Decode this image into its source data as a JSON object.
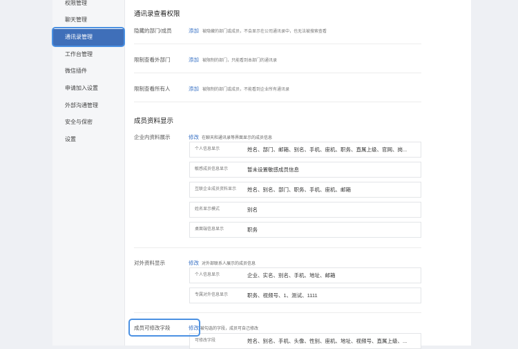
{
  "sidebar": {
    "items": [
      {
        "label": "权限管理"
      },
      {
        "label": "聊天管理"
      },
      {
        "label": "通讯录管理"
      },
      {
        "label": "工作台管理"
      },
      {
        "label": "微信插件"
      },
      {
        "label": "申请加入设置"
      },
      {
        "label": "外部沟通管理"
      },
      {
        "label": "安全与保密"
      },
      {
        "label": "设置"
      }
    ],
    "active_index": 2
  },
  "permissions": {
    "title": "通讯录查看权限",
    "rows": [
      {
        "label": "隐藏的部门/成员",
        "action": "添加",
        "desc": "被隐藏的部门或成员，不会显示在公司通讯录中，也无法被搜索查看"
      },
      {
        "label": "限制查看外部门",
        "action": "添加",
        "desc": "被限制的部门，只能看到本部门的通讯录"
      },
      {
        "label": "限制查看所有人",
        "action": "添加",
        "desc": "被限制的部门或成员，不能看到企业所有通讯录"
      }
    ]
  },
  "member_display": {
    "title": "成员资料显示",
    "internal": {
      "label": "企业内资料展示",
      "action": "修改",
      "desc": "在聊天和通讯录等界面显示的成员信息",
      "fields": [
        {
          "label": "个人信息显示",
          "value": "姓名、部门、邮箱、别名、手机、座机、职务、直属上级、官网、岗..."
        },
        {
          "label": "敏感成员信息显示",
          "value": "暂未设置敏感成员信息"
        },
        {
          "label": "互联企业成员资料显示",
          "value": "姓名、别名、部门、职务、手机、座机、邮箱"
        },
        {
          "label": "姓名显示模式",
          "value": "别名"
        },
        {
          "label": "桌面端信息显示",
          "value": "职务"
        }
      ]
    },
    "external": {
      "label": "对外资料显示",
      "action": "修改",
      "desc": "对外部联系人展示的成员信息",
      "fields": [
        {
          "label": "个人信息显示",
          "value": "企业、实名、别名、手机、地址、邮箱"
        },
        {
          "label": "专属对外信息显示",
          "value": "职务、视频号、1、测试、1111"
        }
      ]
    },
    "editable": {
      "label": "成员可修改字段",
      "action": "修改",
      "desc": "被勾选的字段，成员可自己修改",
      "fields": [
        {
          "label": "可修改字段",
          "value": "姓名、别名、手机、头像、性别、座机、地址、视频号、直属上级、..."
        }
      ]
    }
  }
}
